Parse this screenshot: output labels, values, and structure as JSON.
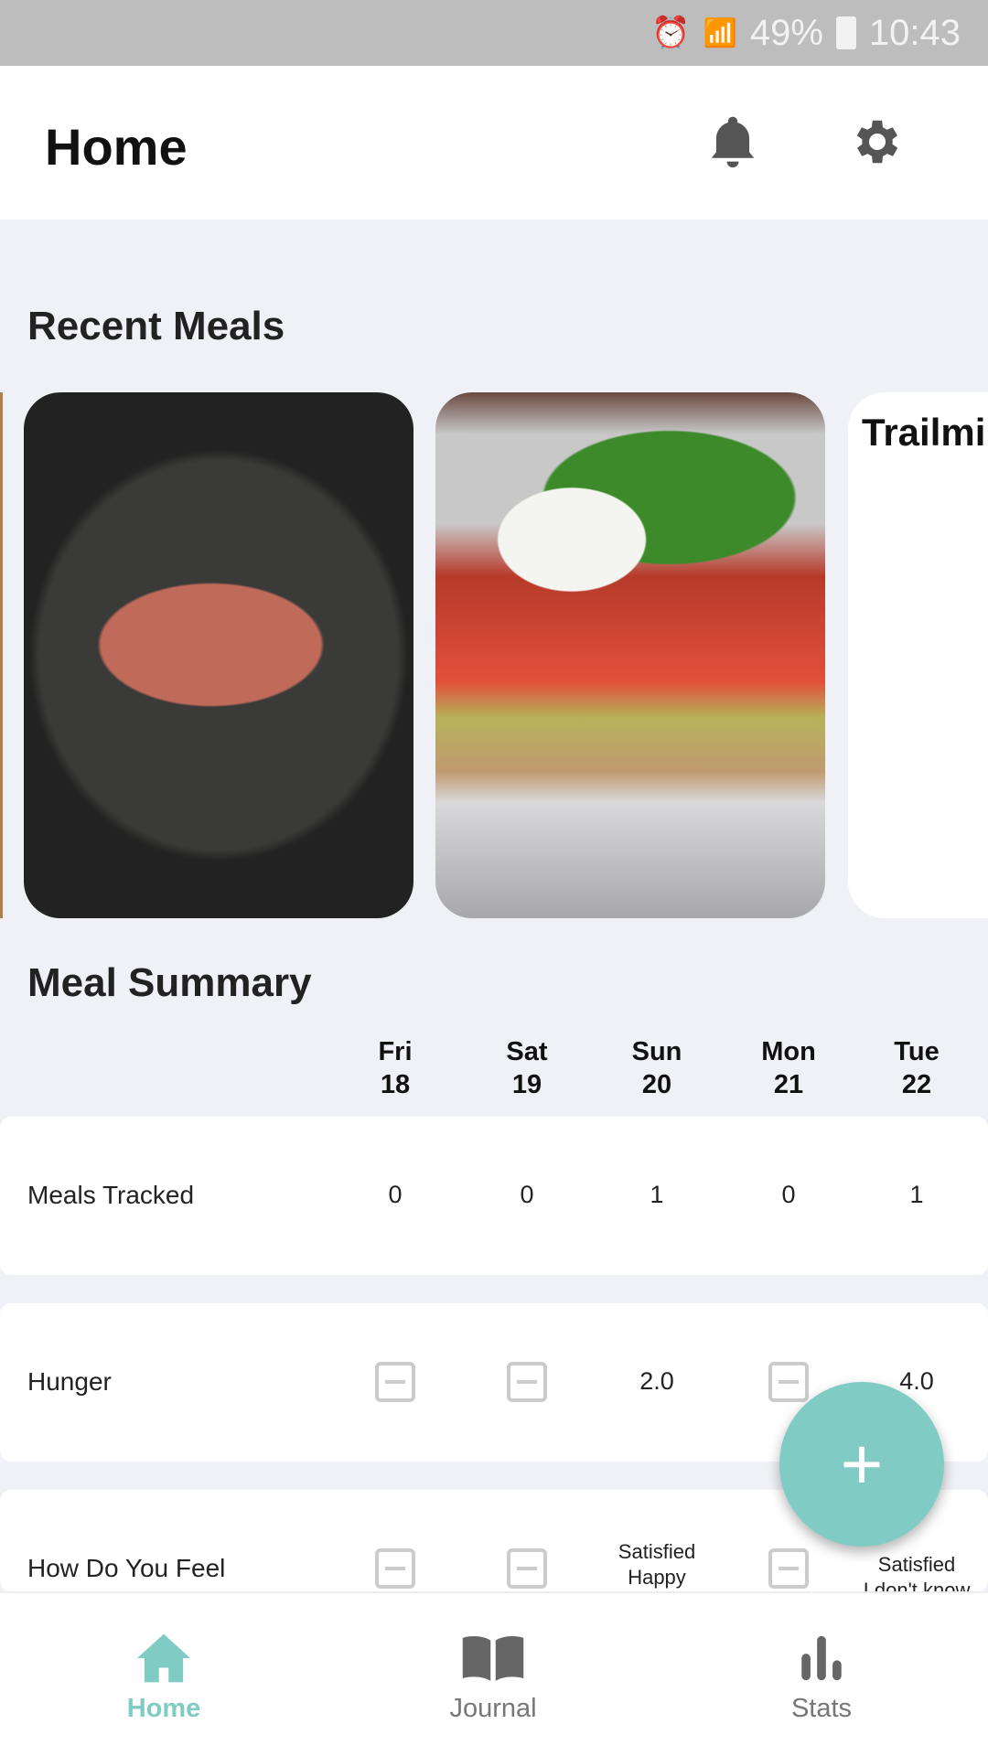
{
  "status_bar": {
    "battery": "49%",
    "time": "10:43"
  },
  "header": {
    "title": "Home",
    "icons": [
      "bell-icon",
      "gear-icon"
    ]
  },
  "recent_meals": {
    "title": "Recent Meals",
    "cards": [
      {
        "type": "photo",
        "subject": "steak"
      },
      {
        "type": "photo",
        "subject": "sandwich"
      },
      {
        "type": "text",
        "title": "Trailmi"
      }
    ]
  },
  "summary": {
    "title": "Meal Summary",
    "days": [
      {
        "dow": "Fri",
        "date": "18"
      },
      {
        "dow": "Sat",
        "date": "19"
      },
      {
        "dow": "Sun",
        "date": "20"
      },
      {
        "dow": "Mon",
        "date": "21"
      },
      {
        "dow": "Tue",
        "date": "22"
      }
    ],
    "rows": [
      {
        "label": "Meals Tracked",
        "values": [
          "0",
          "0",
          "1",
          "0",
          "1"
        ]
      },
      {
        "label": "Hunger",
        "values": [
          "",
          "",
          "2.0",
          "",
          "4.0"
        ]
      },
      {
        "label": "How Do You Feel",
        "values": [
          "",
          "",
          "Satisfied\nHappy\nAnxious",
          "",
          "Satisfied\nI don't know"
        ]
      }
    ]
  },
  "fab": {
    "label": "+",
    "color": "#80cbc4"
  },
  "nav": {
    "items": [
      {
        "label": "Home",
        "active": true
      },
      {
        "label": "Journal"
      },
      {
        "label": "Stats"
      }
    ],
    "active_color": "#80cbc4"
  }
}
